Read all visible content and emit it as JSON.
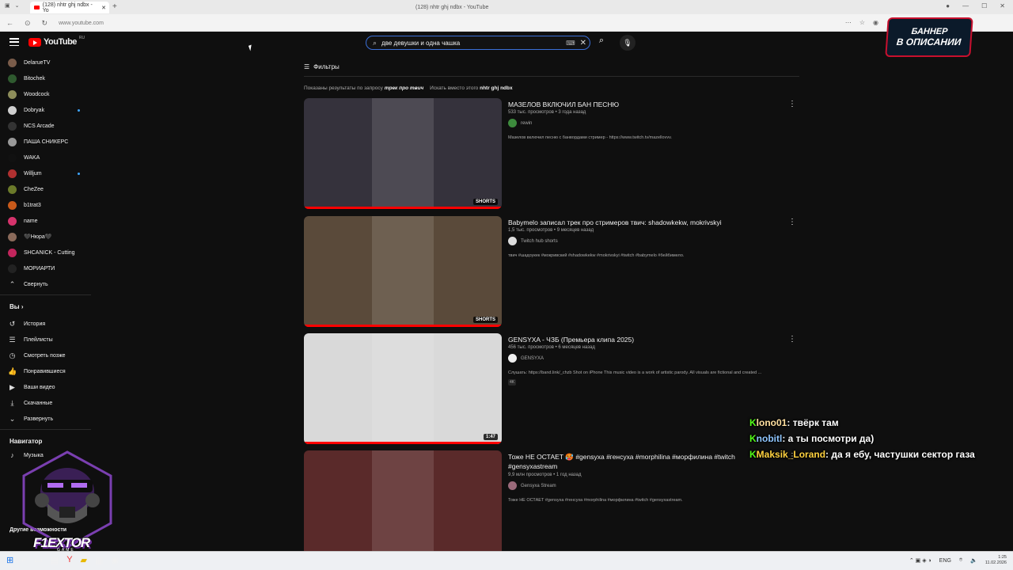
{
  "browser": {
    "tab_title": "(128) nhtr ghj ndbx - Yo",
    "page_title": "(128) nhtr ghj ndbx - YouTube",
    "url": "www.youtube.com"
  },
  "youtube": {
    "logo_text": "YouTube",
    "logo_region": "RU",
    "search_query": "две девушки и одна чашка"
  },
  "sidebar": {
    "subscriptions": [
      {
        "label": "DelarueTV",
        "color": "#7a5c4a",
        "dot": false
      },
      {
        "label": "Bitochek",
        "color": "#2f5a2f",
        "dot": false
      },
      {
        "label": "Woodcock",
        "color": "#8d8d5a",
        "dot": false
      },
      {
        "label": "Dobryak",
        "color": "#cfcfcf",
        "dot": true
      },
      {
        "label": "NCS Arcade",
        "color": "#333333",
        "dot": false
      },
      {
        "label": "ПАША СНИКЕРС",
        "color": "#999999",
        "dot": false
      },
      {
        "label": "WAKA",
        "color": "#111111",
        "dot": false
      },
      {
        "label": "Willjum",
        "color": "#b03030",
        "dot": true
      },
      {
        "label": "CheZee",
        "color": "#6b7a2a",
        "dot": false
      },
      {
        "label": "b1trat3",
        "color": "#c85a1a",
        "dot": false
      },
      {
        "label": "name",
        "color": "#d6336c",
        "dot": false
      },
      {
        "label": "🖤Нюра🖤",
        "color": "#8a6a5a",
        "dot": false
      },
      {
        "label": "SHCANICK - Cutting",
        "color": "#c2255c",
        "dot": false
      },
      {
        "label": "МОРИАРТИ",
        "color": "#222222",
        "dot": false
      }
    ],
    "collapse_label": "Свернуть",
    "you_header": "Вы",
    "you_items": [
      {
        "label": "История",
        "icon": "history-icon",
        "glyph": "↺"
      },
      {
        "label": "Плейлисты",
        "icon": "playlist-icon",
        "glyph": "☰"
      },
      {
        "label": "Смотреть позже",
        "icon": "clock-icon",
        "glyph": "◷"
      },
      {
        "label": "Понравившиеся",
        "icon": "thumbs-up-icon",
        "glyph": "👍"
      },
      {
        "label": "Ваши видео",
        "icon": "video-icon",
        "glyph": "▶"
      },
      {
        "label": "Скачанные",
        "icon": "download-icon",
        "glyph": "⤓"
      },
      {
        "label": "Развернуть",
        "icon": "chevron-down-icon",
        "glyph": "⌄"
      }
    ],
    "navigator_header": "Навигатор",
    "navigator_items": [
      {
        "label": "Музыка",
        "glyph": "♪"
      }
    ],
    "other_header": "Другие возможности"
  },
  "results": {
    "filters_label": "Фильтры",
    "spell_prefix": "Показаны результаты по запросу",
    "spell_corrected": "трек про твич",
    "spell_alt_prefix": "Искать вместо этого",
    "spell_alt": "nhtr ghj ndbx",
    "items": [
      {
        "title": "МАЗЕЛОВ ВКЛЮЧИЛ БАН ПЕСНЮ",
        "meta": "533 тыс. просмотров • 3 года назад",
        "channel": "rewin",
        "channel_color": "#3d8b3d",
        "description": "Мазелов включил песню с банвордами стример - https://www.twitch.tv/mazellovvv.",
        "badge": "SHORTS",
        "thumb_bg": "#35323c",
        "progress": 1.0
      },
      {
        "title": "Babymelo записал трек про стримеров твич: shadowkekw, mokrivskyi",
        "meta": "1,5 тыс. просмотров • 9 месяцев назад",
        "channel": "Twitch hub shorts",
        "channel_color": "#dddddd",
        "description": "твич #шадоукек #мокривский #shadowkekw #mokrivskyi #twitch #babymelo #бейбимело.",
        "badge": "SHORTS",
        "thumb_bg": "#5a4a3a",
        "progress": 1.0
      },
      {
        "title": "GENSYXA - ЧЗБ (Премьера клипа 2025)",
        "meta": "456 тыс. просмотров • 6 месяцев назад",
        "channel": "GENSYXA",
        "channel_color": "#eeeeee",
        "description": "Слушать: https://band.link/_chzb Shot on iPhone This music video is a work of artistic parody. All visuals are fictional and created ...",
        "tag": "4K",
        "badge": "1:47",
        "thumb_bg": "#d9d9d9",
        "progress": 1.0
      },
      {
        "title": "Тоже НЕ ОСТАЕТ 🥵 #gensyxa #генсуха #morphilina #морфилина #twitch #gensyxastream",
        "meta": "9,9 млн просмотров • 1 год назад",
        "channel": "Gensyxa Stream",
        "channel_color": "#9a6a7a",
        "description": "Тоже НЕ ОСТАЕТ #gensyxa #генсуха #morphilina #морфилина #twitch #gensyxastream.",
        "badge": "",
        "thumb_bg": "#5a2a2a",
        "progress": 0
      }
    ]
  },
  "overlay": {
    "banner_line1": "БАННЕР",
    "banner_line2": "В ОПИСАНИИ",
    "chat": [
      {
        "user": "lono01",
        "text": "твёрк там"
      },
      {
        "user": "nobitl",
        "text": "а ты посмотри да)"
      },
      {
        "user": "Maksik_Lorand",
        "text": "да я ебу, частушки сектор газа"
      }
    ],
    "logo_name": "F1EXTOR",
    "logo_sub": "GAME"
  },
  "taskbar": {
    "lang": "ENG",
    "time": "1:25",
    "date": "11.02.2026"
  }
}
